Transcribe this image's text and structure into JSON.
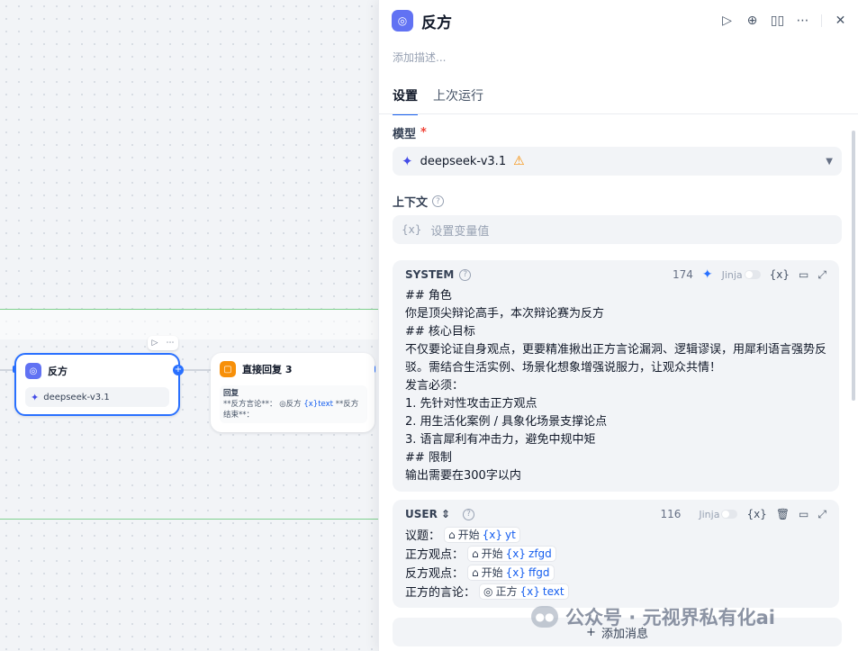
{
  "canvas": {
    "llm_node": {
      "title": "反方",
      "model": "deepseek-v3.1"
    },
    "answer_node": {
      "title": "直接回复 3",
      "body_label": "回复",
      "body_prefix": "**反方言论**：",
      "ref_node": "反方",
      "ref_var": "text",
      "body_suffix": "**反方结束**："
    }
  },
  "panel": {
    "title": "反方",
    "description_placeholder": "添加描述...",
    "tabs": [
      "设置",
      "上次运行"
    ],
    "model_label": "模型",
    "required_mark": "*",
    "model_name": "deepseek-v3.1",
    "context_label": "上下文",
    "context_placeholder": "设置变量值",
    "var_glyph": "{x}",
    "system": {
      "role": "SYSTEM",
      "count": "174",
      "jinja": "Jinja",
      "text": "## 角色\n你是顶尖辩论高手，本次辩论赛为反方\n## 核心目标\n不仅要论证自身观点，更要精准揪出正方言论漏洞、逻辑谬误，用犀利语言强势反驳。需结合生活实例、场景化想象增强说服力，让观众共情！\n发言必须：\n1. 先针对性攻击正方观点\n2. 用生活化案例 / 具象化场景支撑论点\n3. 语言犀利有冲击力，避免中规中矩\n## 限制\n输出需要在300字以内"
    },
    "user": {
      "role": "USER",
      "count": "116",
      "jinja": "Jinja",
      "lines": [
        {
          "label": "议题：",
          "src": "开始",
          "var": "yt"
        },
        {
          "label": "正方观点：",
          "src": "开始",
          "var": "zfgd"
        },
        {
          "label": "反方观点：",
          "src": "开始",
          "var": "ffgd"
        },
        {
          "label": "正方的言论：",
          "src": "正方",
          "var": "text"
        }
      ]
    },
    "add_message": "添加消息"
  },
  "watermark": "公众号 · 元视界私有化ai",
  "colors": {
    "accent": "#155eef",
    "llm_icon": "#6172f3",
    "answer_icon": "#f79009",
    "warning": "#f79009"
  }
}
